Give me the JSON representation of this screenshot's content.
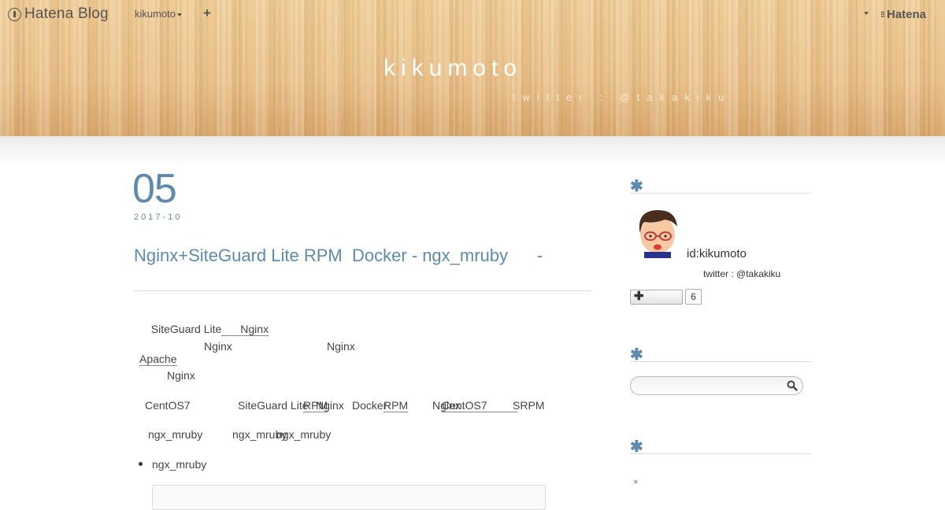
{
  "globalbar": {
    "logo_text": "Hatena Blog",
    "user": "kikumoto",
    "plus": "+",
    "brand": "Hatena"
  },
  "blog": {
    "title": "kikumoto",
    "subtitle": "twitter : @takakiku"
  },
  "entry": {
    "day": "05",
    "year_month": "2017-10",
    "title": "Nginx+SiteGuard Lite RPM  Docker - ngx_mruby      -",
    "p1": {
      "a": "SiteGuard Lite",
      "link": "Nginx"
    },
    "p2": {
      "link": "Apache",
      "b": "Nginx",
      "c": "Nginx"
    },
    "p3": "Nginx",
    "p4": {
      "a": "CentOS7",
      "b": "SiteGuard Lite",
      "c": "RPM",
      "d": "Nginx",
      "e": "Docker",
      "f": "RPM",
      "g": "Nginx",
      "h": "CentOS7",
      "i": "SRPM"
    },
    "p5": {
      "a": "ngx_mruby",
      "b": "ngx_mruby",
      "c": "ngx_mruby"
    },
    "bullet": "ngx_mruby",
    "code_preview": "hatena-blog-code"
  },
  "sidebar": {
    "profile": {
      "id": "id:kikumoto",
      "description": "twitter : @takakiku",
      "subscribe_count": "6"
    },
    "search": {
      "placeholder": ""
    },
    "misc": "。"
  },
  "colors": {
    "accent": "#5d8aaf",
    "header_wood": "#e9c08a"
  }
}
